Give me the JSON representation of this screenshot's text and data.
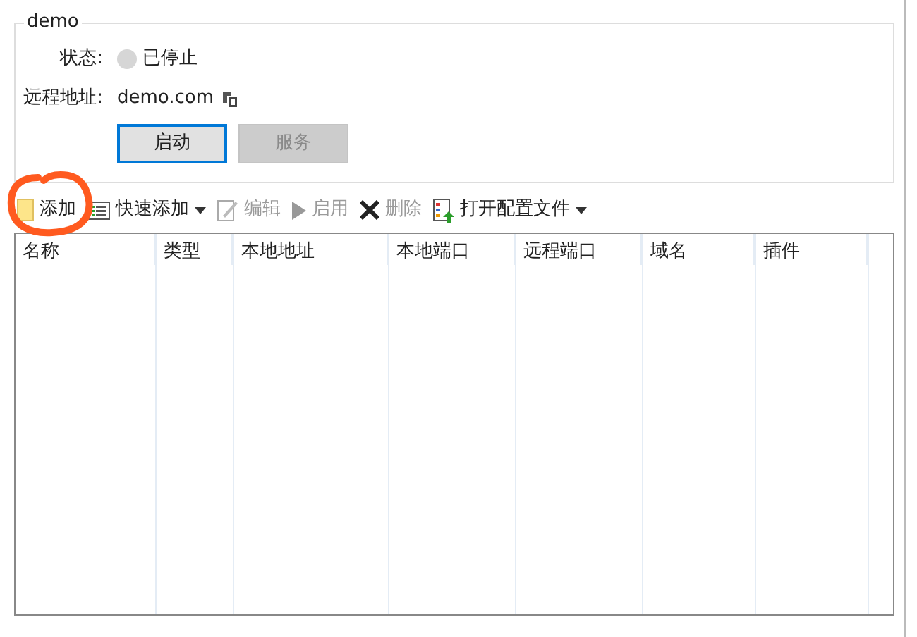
{
  "group": {
    "title": "demo",
    "status": {
      "label": "状态:",
      "value": "已停止",
      "running": false
    },
    "address": {
      "label": "远程地址:",
      "value": "demo.com"
    },
    "buttons": [
      {
        "label": "启动",
        "disabled": false,
        "focused": true
      },
      {
        "label": "服务",
        "disabled": true,
        "focused": false
      }
    ]
  },
  "toolbar": [
    {
      "kind": "add",
      "label": "添加",
      "disabled": false,
      "dropdown": false
    },
    {
      "kind": "quick",
      "label": "快速添加",
      "disabled": false,
      "dropdown": true
    },
    {
      "kind": "edit",
      "label": "编辑",
      "disabled": true,
      "dropdown": false
    },
    {
      "kind": "enable",
      "label": "启用",
      "disabled": true,
      "dropdown": false
    },
    {
      "kind": "delete",
      "label": "删除",
      "disabled": true,
      "dropdown": false
    },
    {
      "kind": "config",
      "label": "打开配置文件",
      "disabled": false,
      "dropdown": true
    }
  ],
  "table": {
    "columns": [
      "名称",
      "类型",
      "本地地址",
      "本地端口",
      "远程端口",
      "域名",
      "插件"
    ]
  }
}
